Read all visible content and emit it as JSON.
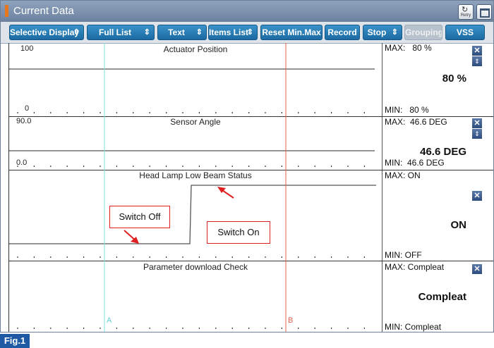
{
  "window": {
    "title": "Current Data",
    "retry_label": "Retry"
  },
  "toolbar": {
    "selective_display": "Selective Display",
    "full_list": "Full List",
    "text": "Text",
    "items_list": "Items List",
    "reset_min_max": "Reset Min.Max",
    "record": "Record",
    "stop": "Stop",
    "grouping": "Grouping",
    "vss": "VSS"
  },
  "cursors": {
    "a_label": "A",
    "b_label": "B"
  },
  "panels": [
    {
      "title": "Actuator Position",
      "scale_max": "100",
      "scale_min": "0",
      "max": "MAX:   80 %",
      "min": "MIN:   80 %",
      "value": "80 %",
      "level": 0.8
    },
    {
      "title": "Sensor Angle",
      "scale_max": "90.0",
      "scale_min": "0.0",
      "max": "MAX:  46.6 DEG",
      "min": "MIN:  46.6 DEG",
      "value": "46.6 DEG",
      "level": 0.52
    },
    {
      "title": "Head Lamp Low Beam Status",
      "max": "MAX: ON",
      "min": "MIN: OFF",
      "value": "ON",
      "level_low": "OFF",
      "level_high": "ON"
    },
    {
      "title": "Parameter download Check",
      "max": "MAX: Compleat",
      "min": "MIN: Compleat",
      "value": "Compleat"
    }
  ],
  "annotations": {
    "switch_off": "Switch Off",
    "switch_on": "Switch On"
  },
  "figure_label": "Fig.1",
  "colors": {
    "toolbar_button": "#1c6aa3",
    "cursor_a": "#66d4d4",
    "cursor_b": "#e2604a",
    "callout_border": "#e02020"
  }
}
